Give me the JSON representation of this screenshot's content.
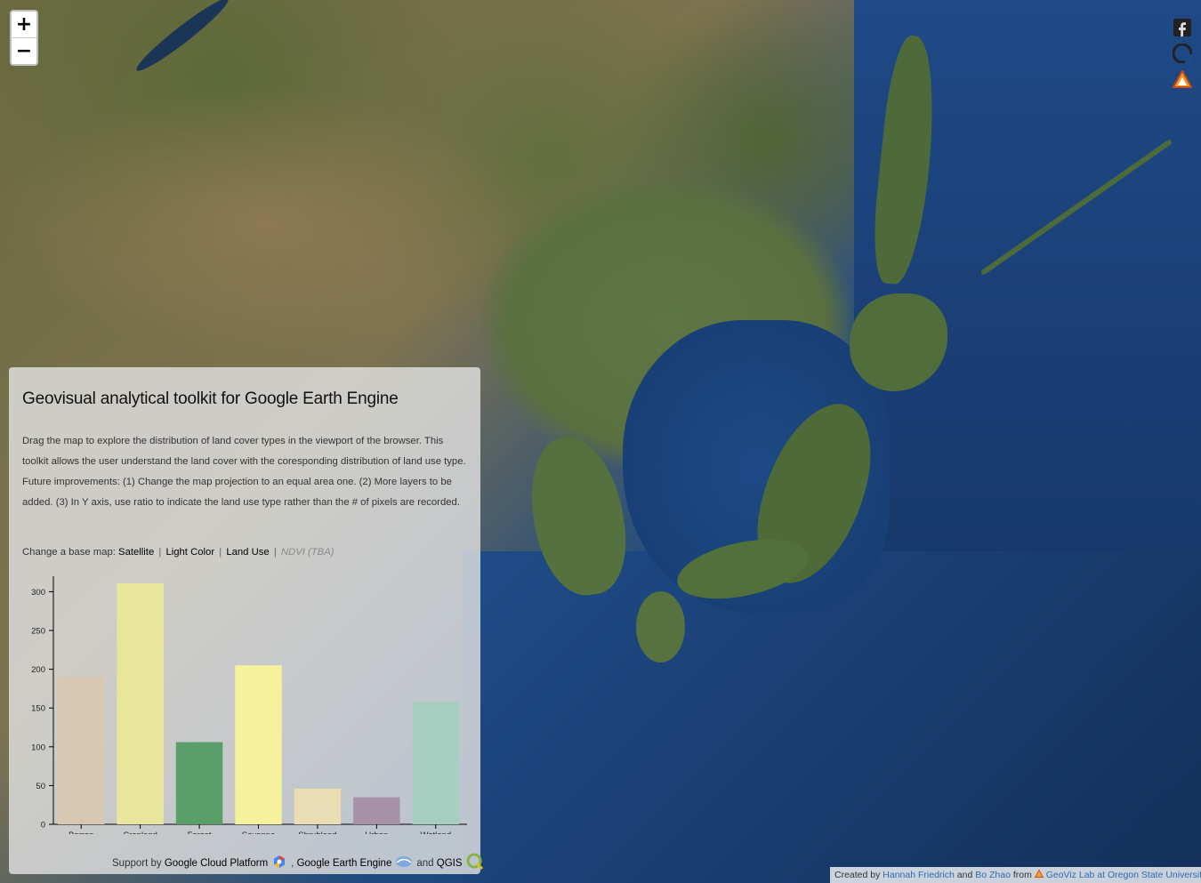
{
  "zoom": {
    "in_label": "+",
    "out_label": "−"
  },
  "social": {
    "icons": [
      "facebook-icon",
      "github-icon",
      "geoviz-logo-icon"
    ]
  },
  "panel": {
    "title": "Geovisual analytical toolkit for Google Earth Engine",
    "description": "Drag the map to explore the distribution of land cover types in the viewport of the browser. This toolkit allows the user understand the land cover with the coresponding distribution of land use type. Future improvements: (1) Change the map projection to an equal area one. (2) More layers to be added. (3) In Y axis, use ratio to indicate the land use type rather than the # of pixels are recorded.",
    "basemap": {
      "prefix": "Change a base map:",
      "options": [
        "Satellite",
        "Light Color",
        "Land Use"
      ],
      "separator": "|",
      "disabled": "NDVI (TBA)"
    },
    "support": {
      "prefix": "Support by",
      "item1": "Google Cloud Platform",
      "comma": ",",
      "item2": "Google Earth Engine",
      "and": "and",
      "item3": "QGIS"
    }
  },
  "chart_data": {
    "type": "bar",
    "categories": [
      "Barren",
      "Cropland",
      "Forest",
      "Savanna",
      "Shrubland",
      "Urban",
      "Wetland"
    ],
    "values": [
      190,
      311,
      106,
      205,
      46,
      35,
      158
    ],
    "colors": [
      "#d8c7b3",
      "#e8e69c",
      "#5a9e6a",
      "#f6f29c",
      "#eadcb3",
      "#a792a8",
      "#a7cdc0"
    ],
    "yticks": [
      0,
      50,
      100,
      150,
      200,
      250,
      300
    ],
    "ylim": [
      0,
      320
    ]
  },
  "attribution": {
    "created_by": "Created by",
    "author1": "Hannah Friedrich",
    "and": "and",
    "author2": "Bo Zhao",
    "from": "from",
    "lab": "GeoViz Lab at Oregon State University"
  }
}
